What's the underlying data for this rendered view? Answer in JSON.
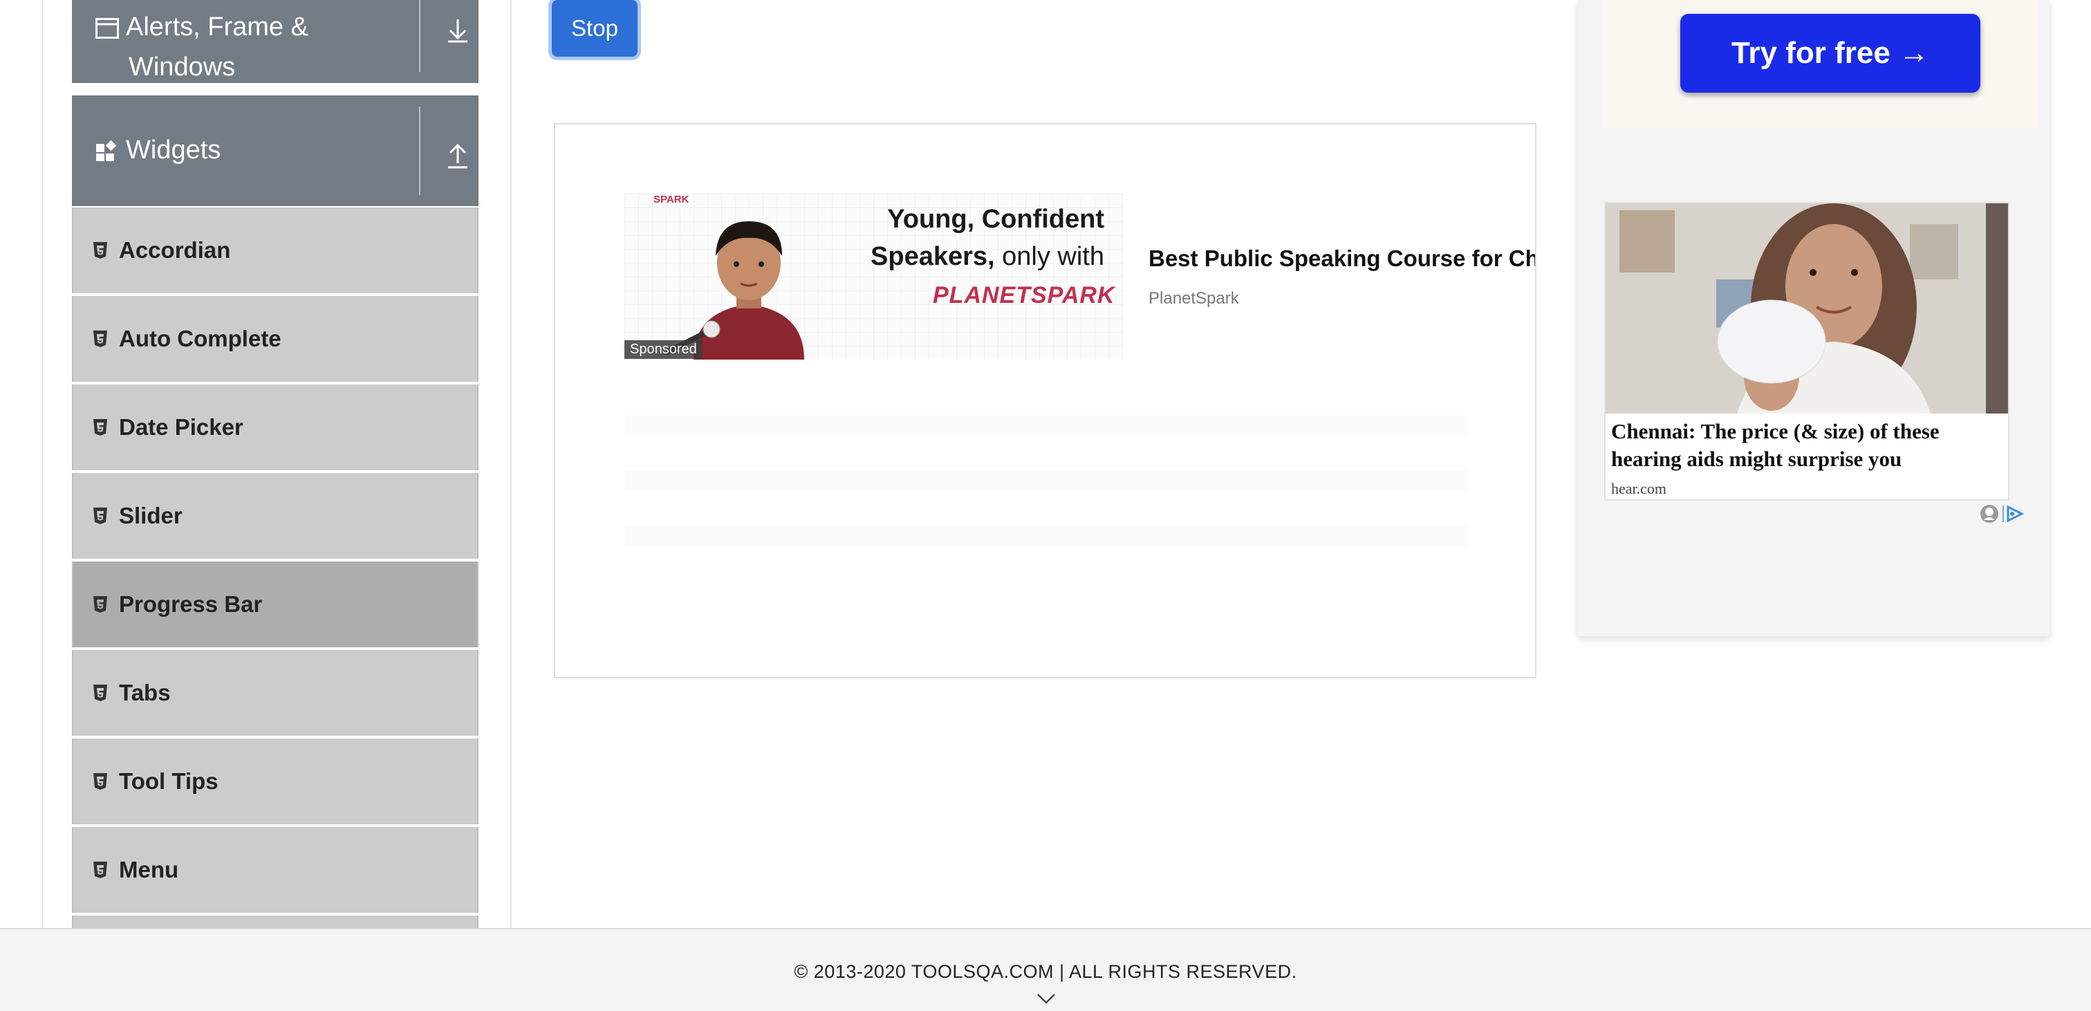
{
  "sidebar": {
    "alerts_group": {
      "label_line1": "Alerts, Frame &",
      "label_line2": "Windows"
    },
    "widgets_group": {
      "label": "Widgets"
    },
    "items": [
      {
        "label": "Accordian"
      },
      {
        "label": "Auto Complete"
      },
      {
        "label": "Date Picker"
      },
      {
        "label": "Slider"
      },
      {
        "label": "Progress Bar"
      },
      {
        "label": "Tabs"
      },
      {
        "label": "Tool Tips"
      },
      {
        "label": "Menu"
      }
    ],
    "active_item": "Progress Bar"
  },
  "main": {
    "stop_button": "Stop"
  },
  "ad": {
    "banner_brand_small": "SPARK",
    "banner_headline_1": "Young, Confident",
    "banner_headline_2_bold": "Speakers,",
    "banner_headline_2_light": " only with",
    "banner_logo": "PLANETSPARK",
    "sponsored_tag": "Sponsored",
    "title": "Best Public Speaking Course for Children",
    "source": "PlanetSpark"
  },
  "right_ads": {
    "try_button": "Try for free →",
    "news_headline": "Chennai: The price (& size) of these hearing aids might surprise you",
    "news_source": "hear.com"
  },
  "footer": {
    "copyright": "© 2013-2020 TOOLSQA.COM | ALL RIGHTS RESERVED."
  },
  "colors": {
    "group_header_bg": "#737b84",
    "menu_item_bg": "#cccccc",
    "menu_item_active_bg": "#adadad",
    "stop_button_bg": "#2c6fd6",
    "try_button_bg": "#1a2be8",
    "footer_bg": "#f4f4f4"
  }
}
